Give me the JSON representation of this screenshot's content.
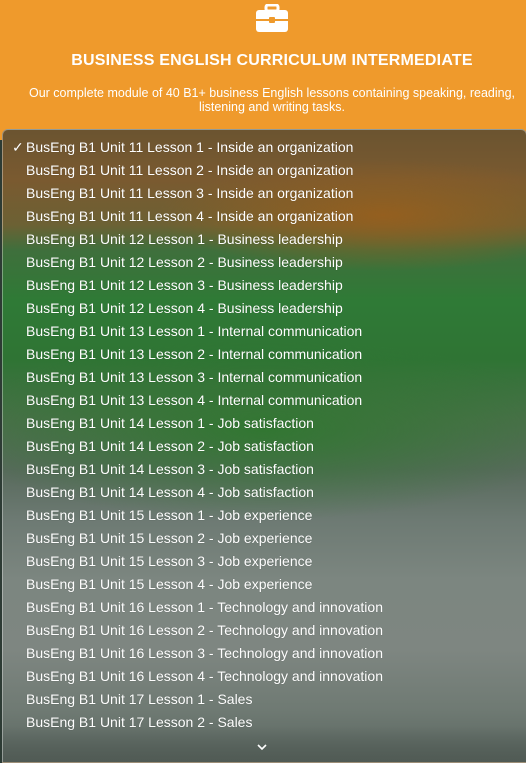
{
  "header": {
    "icon": "briefcase-icon",
    "title": "BUSINESS ENGLISH CURRICULUM INTERMEDIATE",
    "subtitle": "Our complete module of 40 B1+ business English lessons containing speaking, reading, listening and writing tasks."
  },
  "dropdown": {
    "selected_index": 0,
    "items": [
      "BusEng B1 Unit 11 Lesson 1 - Inside an organization",
      "BusEng B1 Unit 11 Lesson 2 - Inside an organization",
      "BusEng B1 Unit 11 Lesson 3 - Inside an organization",
      "BusEng B1 Unit 11 Lesson 4 - Inside an organization",
      "BusEng B1 Unit 12 Lesson 1 - Business leadership",
      "BusEng B1 Unit 12 Lesson 2 - Business leadership",
      "BusEng B1 Unit 12 Lesson 3 - Business leadership",
      "BusEng B1 Unit 12 Lesson 4 - Business leadership",
      "BusEng B1 Unit 13 Lesson 1 - Internal communication",
      "BusEng B1 Unit 13 Lesson 2 - Internal communication",
      "BusEng B1 Unit 13 Lesson 3 - Internal communication",
      "BusEng B1 Unit 13 Lesson 4 - Internal communication",
      "BusEng B1 Unit 14 Lesson 1 - Job satisfaction",
      "BusEng B1 Unit 14 Lesson 2 - Job satisfaction",
      "BusEng B1 Unit 14 Lesson 3 - Job satisfaction",
      "BusEng B1 Unit 14 Lesson 4 - Job satisfaction",
      "BusEng B1 Unit 15 Lesson 1 - Job experience",
      "BusEng B1 Unit 15 Lesson 2 - Job experience",
      "BusEng B1 Unit 15 Lesson 3 - Job experience",
      "BusEng B1 Unit 15 Lesson 4 - Job experience",
      "BusEng B1 Unit 16 Lesson 1 - Technology and innovation",
      "BusEng B1 Unit 16 Lesson 2 - Technology and innovation",
      "BusEng B1 Unit 16 Lesson 3 - Technology and innovation",
      "BusEng B1 Unit 16 Lesson 4 - Technology and innovation",
      "BusEng B1 Unit 17 Lesson 1 - Sales",
      "BusEng B1 Unit 17 Lesson 2 - Sales"
    ],
    "check_mark": "✓",
    "scroll_icon": "chevron-down-icon"
  },
  "colors": {
    "header_bg": "#ef9a2c",
    "text": "#ffffff"
  }
}
